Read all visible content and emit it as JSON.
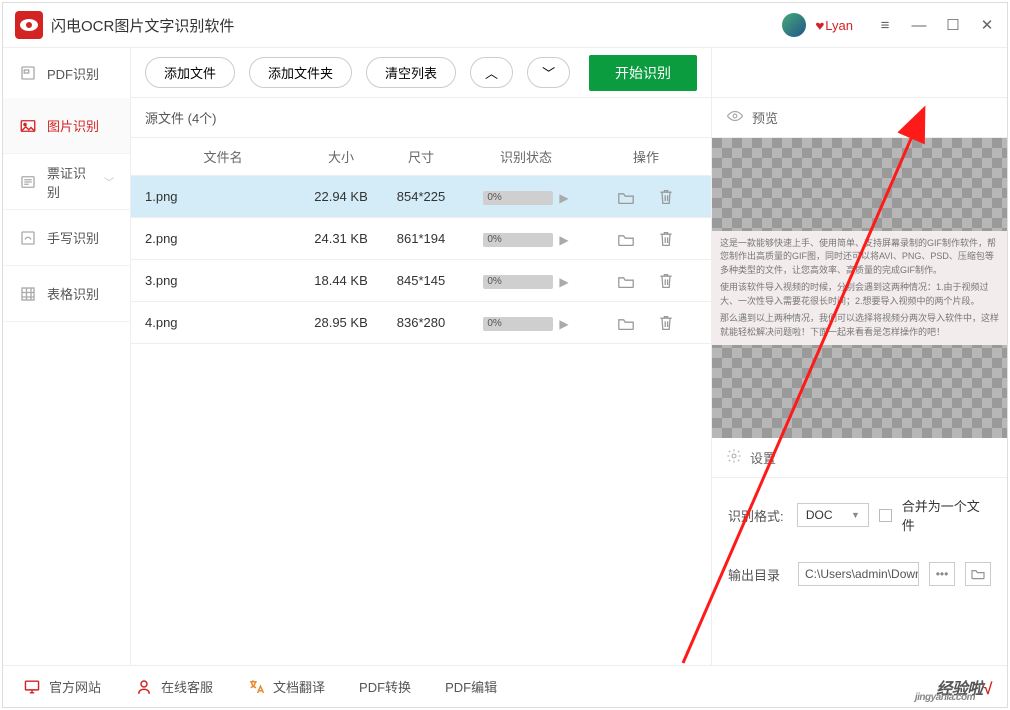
{
  "title": "闪电OCR图片文字识别软件",
  "user": {
    "name": "Lyan",
    "vip_icon": "♥"
  },
  "window_controls": {
    "menu": "≡",
    "min": "—",
    "max": "☐",
    "close": "✕"
  },
  "sidebar": {
    "items": [
      {
        "label": "PDF识别",
        "has_expand": false
      },
      {
        "label": "图片识别",
        "has_expand": false,
        "active": true
      },
      {
        "label": "票证识别",
        "has_expand": true
      },
      {
        "label": "手写识别",
        "has_expand": false
      },
      {
        "label": "表格识别",
        "has_expand": false
      }
    ]
  },
  "toolbar": {
    "add_file": "添加文件",
    "add_folder": "添加文件夹",
    "clear_list": "清空列表",
    "move_up": "︿",
    "move_down": "﹀",
    "start": "开始识别"
  },
  "list": {
    "header_label": "源文件 (4个)",
    "columns": {
      "name": "文件名",
      "size": "大小",
      "dim": "尺寸",
      "status": "识别状态",
      "ops": "操作"
    },
    "rows": [
      {
        "name": "1.png",
        "size": "22.94 KB",
        "dim": "854*225",
        "progress": "0%",
        "selected": true
      },
      {
        "name": "2.png",
        "size": "24.31 KB",
        "dim": "861*194",
        "progress": "0%",
        "selected": false
      },
      {
        "name": "3.png",
        "size": "18.44 KB",
        "dim": "845*145",
        "progress": "0%",
        "selected": false
      },
      {
        "name": "4.png",
        "size": "28.95 KB",
        "dim": "836*280",
        "progress": "0%",
        "selected": false
      }
    ]
  },
  "preview": {
    "title": "预览",
    "sample_line1": "这是一款能够快速上手、使用简单、支持屏幕录制的GIF制作软件，帮您制作出高质量的GIF图，同时还可以将AVI、PNG、PSD、压缩包等多种类型的文件，让您高效率、高质量的完成GIF制作。",
    "sample_line2": "使用该软件导入视频的时候，分别会遇到这两种情况：1.由于视频过大、一次性导入需要花很长时间；2.想要导入视频中的两个片段。",
    "sample_line3": "那么遇到以上两种情况，我们可以选择将视频分两次导入软件中，这样就能轻松解决问题啦！下面一起来看看是怎样操作的吧！"
  },
  "settings": {
    "title": "设置",
    "format_label": "识别格式:",
    "format_value": "DOC",
    "merge_label": "合并为一个文件",
    "outdir_label": "输出目录",
    "outdir_value": "C:\\Users\\admin\\Downlo",
    "more": "•••"
  },
  "footer": {
    "items": [
      {
        "label": "官方网站"
      },
      {
        "label": "在线客服"
      },
      {
        "label": "文档翻译"
      },
      {
        "label": "PDF转换"
      },
      {
        "label": "PDF编辑"
      }
    ]
  },
  "watermark": {
    "main": "经验啦",
    "check": "√",
    "sub": "jingyanla.com"
  }
}
